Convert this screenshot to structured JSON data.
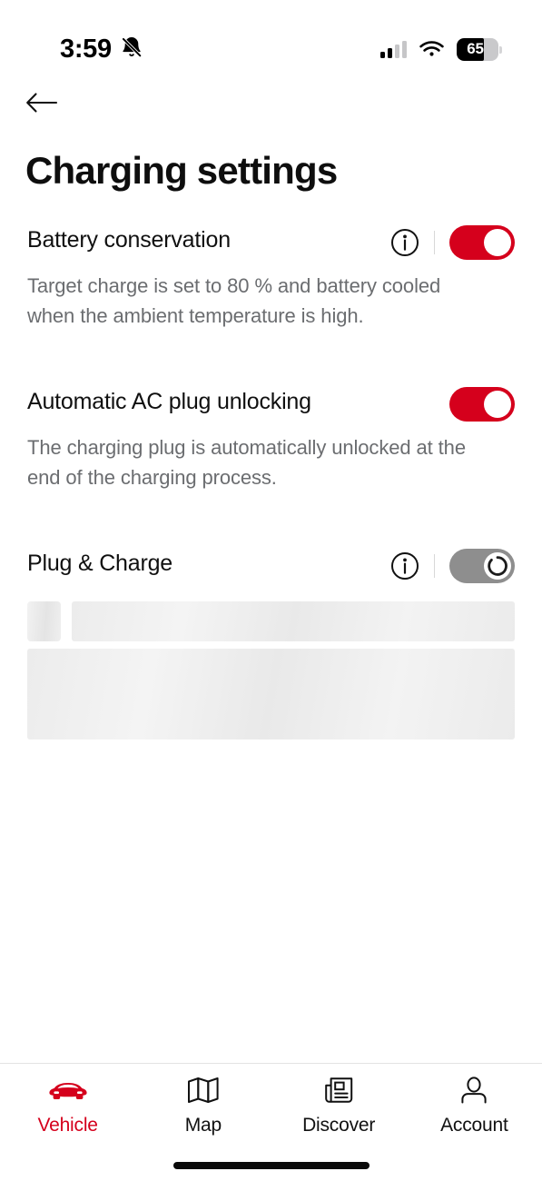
{
  "status_bar": {
    "time": "3:59",
    "silent_icon": "bell-slash-icon",
    "cellular_icon": "cellular-signal-icon",
    "wifi_icon": "wifi-icon",
    "battery_percent": "65",
    "battery_level": 65
  },
  "header": {
    "back_icon": "back-arrow-icon",
    "title": "Charging settings"
  },
  "settings": [
    {
      "id": "battery-conservation",
      "title": "Battery conservation",
      "description": "Target charge is set to 80 % and battery cooled when the ambient temperature is high.",
      "has_info": true,
      "info_icon": "info-icon",
      "toggle_state": "on"
    },
    {
      "id": "automatic-ac-plug-unlocking",
      "title": "Automatic AC plug unlocking",
      "description": "The charging plug is automatically unlocked at the end of the charging process.",
      "has_info": false,
      "toggle_state": "on"
    },
    {
      "id": "plug-and-charge",
      "title": "Plug & Charge",
      "description": "",
      "has_info": true,
      "info_icon": "info-icon",
      "toggle_state": "loading"
    }
  ],
  "loading_placeholders": {
    "visible": true,
    "square": true,
    "bar": true,
    "block": true
  },
  "tabbar": {
    "items": [
      {
        "label": "Vehicle",
        "icon": "car-icon",
        "active": true
      },
      {
        "label": "Map",
        "icon": "map-icon",
        "active": false
      },
      {
        "label": "Discover",
        "icon": "newspaper-icon",
        "active": false
      },
      {
        "label": "Account",
        "icon": "person-icon",
        "active": false
      }
    ]
  },
  "colors": {
    "accent_red": "#D5001C",
    "title_black": "#0E0E0E",
    "body_gray": "#6B6D70",
    "toggle_pending_gray": "#8E8E8E"
  }
}
